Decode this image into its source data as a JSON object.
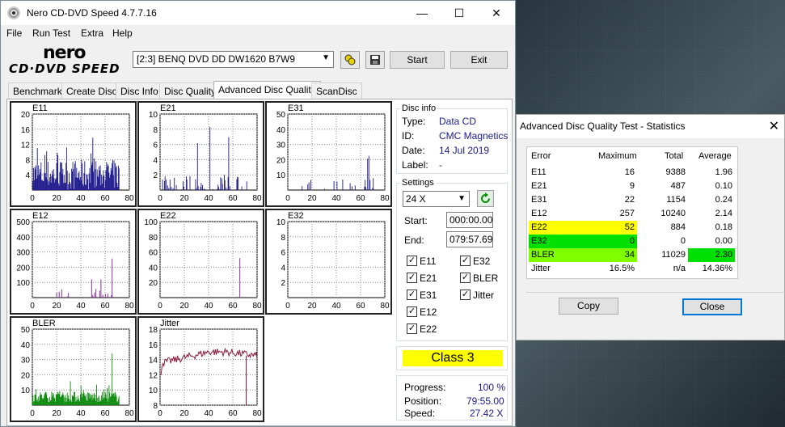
{
  "window": {
    "title": "Nero CD-DVD Speed 4.7.7.16",
    "minimize_glyph": "—",
    "maximize_glyph": "☐",
    "close_glyph": "✕"
  },
  "menu": [
    "File",
    "Run Test",
    "Extra",
    "Help"
  ],
  "logo": {
    "line1": "nero",
    "line2": "CD·DVD SPEED"
  },
  "drive": {
    "selected": "[2:3]   BENQ DVD DD DW1620 B7W9"
  },
  "toolbar": {
    "start_label": "Start",
    "exit_label": "Exit"
  },
  "tabs": [
    "Benchmark",
    "Create Disc",
    "Disc Info",
    "Disc Quality",
    "Advanced Disc Quality",
    "ScanDisc"
  ],
  "active_tab": "Advanced Disc Quality",
  "disc_info": {
    "group_label": "Disc info",
    "type_label": "Type:",
    "type": "Data CD",
    "id_label": "ID:",
    "id": "CMC Magnetics",
    "date_label": "Date:",
    "date": "14 Jul 2019",
    "label_label": "Label:",
    "label": "-"
  },
  "settings": {
    "group_label": "Settings",
    "speed": "24 X",
    "start_label": "Start:",
    "start": "000:00.00",
    "end_label": "End:",
    "end": "079:57.69",
    "checks": [
      {
        "label": "E11",
        "checked": true
      },
      {
        "label": "E32",
        "checked": true
      },
      {
        "label": "E21",
        "checked": true
      },
      {
        "label": "BLER",
        "checked": true
      },
      {
        "label": "E31",
        "checked": true
      },
      {
        "label": "Jitter",
        "checked": true
      },
      {
        "label": "E12",
        "checked": true
      },
      {
        "label": "E22",
        "checked": true
      }
    ]
  },
  "class_label": "Class 3",
  "progress": {
    "progress_label": "Progress:",
    "progress": "100 %",
    "position_label": "Position:",
    "position": "79:55.00",
    "speed_label": "Speed:",
    "speed": "27.42 X"
  },
  "chart_data": [
    {
      "type": "bar",
      "name": "E11",
      "x_ticks": [
        0,
        20,
        40,
        60,
        80
      ],
      "y_ticks": [
        4,
        8,
        12,
        16,
        20
      ],
      "ylim": [
        0,
        20
      ],
      "color": "#1e1a8c"
    },
    {
      "type": "bar",
      "name": "E21",
      "x_ticks": [
        0,
        20,
        40,
        60,
        80
      ],
      "y_ticks": [
        2,
        4,
        6,
        8,
        10
      ],
      "ylim": [
        0,
        10
      ],
      "color": "#1e1a8c"
    },
    {
      "type": "bar",
      "name": "E31",
      "x_ticks": [
        0,
        20,
        40,
        60,
        80
      ],
      "y_ticks": [
        10,
        20,
        30,
        40,
        50
      ],
      "ylim": [
        0,
        50
      ],
      "color": "#1e1a8c"
    },
    {
      "type": "bar",
      "name": "E12",
      "x_ticks": [
        0,
        20,
        40,
        60,
        80
      ],
      "y_ticks": [
        100,
        200,
        300,
        400,
        500
      ],
      "ylim": [
        0,
        500
      ],
      "color": "#7a1a8c"
    },
    {
      "type": "bar",
      "name": "E22",
      "x_ticks": [
        0,
        20,
        40,
        60,
        80
      ],
      "y_ticks": [
        20,
        40,
        60,
        80,
        100
      ],
      "ylim": [
        0,
        100
      ],
      "color": "#7a1a8c"
    },
    {
      "type": "bar",
      "name": "E32",
      "x_ticks": [
        0,
        20,
        40,
        60,
        80
      ],
      "y_ticks": [
        2,
        4,
        6,
        8,
        10
      ],
      "ylim": [
        0,
        10
      ],
      "color": "#7a1a8c"
    },
    {
      "type": "bar",
      "name": "BLER",
      "x_ticks": [
        0,
        20,
        40,
        60,
        80
      ],
      "y_ticks": [
        10,
        20,
        30,
        40,
        50
      ],
      "ylim": [
        0,
        50
      ],
      "color": "#0a8a0a"
    },
    {
      "type": "line",
      "name": "Jitter",
      "x_ticks": [
        0,
        20,
        40,
        60,
        80
      ],
      "y_ticks": [
        8,
        10,
        12,
        14,
        16,
        18
      ],
      "ylim": [
        8,
        18
      ],
      "color": "#8c1a3c"
    }
  ],
  "stats": {
    "title": "Advanced Disc Quality Test - Statistics",
    "headers": [
      "Error",
      "Maximum",
      "Total",
      "Average"
    ],
    "rows": [
      [
        "E11",
        "16",
        "9388",
        "1.96"
      ],
      [
        "E21",
        "9",
        "487",
        "0.10"
      ],
      [
        "E31",
        "22",
        "1154",
        "0.24"
      ],
      [
        "E12",
        "257",
        "10240",
        "2.14"
      ],
      [
        "E22",
        "52",
        "884",
        "0.18"
      ],
      [
        "E32",
        "0",
        "0",
        "0.00"
      ],
      [
        "BLER",
        "34",
        "11029",
        "2.30"
      ],
      [
        "Jitter",
        "16.5%",
        "n/a",
        "14.36%"
      ]
    ],
    "copy_label": "Copy",
    "close_label": "Close"
  }
}
